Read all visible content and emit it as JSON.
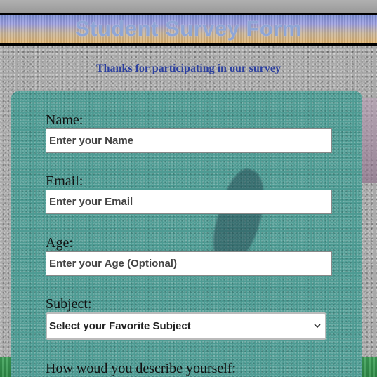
{
  "header": {
    "title": "Student Survey Form"
  },
  "intro": {
    "subtitle": "Thanks for participating in our survey"
  },
  "form": {
    "name_label": "Name:",
    "name_placeholder": "Enter your Name",
    "email_label": "Email:",
    "email_placeholder": "Enter your Email",
    "age_label": "Age:",
    "age_placeholder": "Enter your Age (Optional)",
    "subject_label": "Subject:",
    "subject_selected": "Select your Favorite Subject",
    "describe_label": "How woud you describe yourself:"
  },
  "icons": {
    "dropdown": "chevron-down-icon"
  },
  "colors": {
    "panel": "#4d9b93",
    "title_text": "#8fa6d6",
    "subtitle_text": "#2b3fa0"
  }
}
